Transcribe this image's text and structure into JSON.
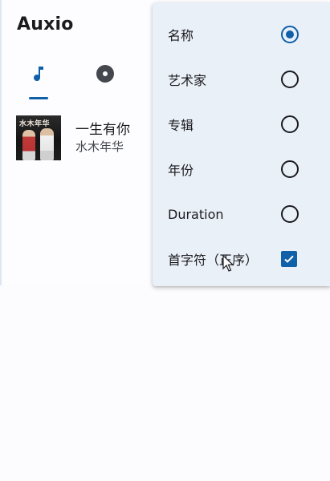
{
  "app": {
    "title": "Auxio"
  },
  "tabs": [
    {
      "name": "songs",
      "icon": "music-note-icon",
      "selected": true
    },
    {
      "name": "albums",
      "icon": "album-disc-icon",
      "selected": false
    }
  ],
  "songs": [
    {
      "title": "一生有你",
      "artist": "水木年华",
      "cover_text": "水木年华"
    }
  ],
  "sort_menu": {
    "options": [
      {
        "label": "名称",
        "selected": true
      },
      {
        "label": "艺术家",
        "selected": false
      },
      {
        "label": "专辑",
        "selected": false
      },
      {
        "label": "年份",
        "selected": false
      },
      {
        "label": "Duration",
        "selected": false
      }
    ],
    "ascending": {
      "label": "首字符（正序）",
      "checked": true
    }
  },
  "colors": {
    "accent": "#0f5fa9",
    "menu_background": "#eaf0f8",
    "text_primary": "#1b1b1f",
    "text_secondary": "#44474e"
  }
}
